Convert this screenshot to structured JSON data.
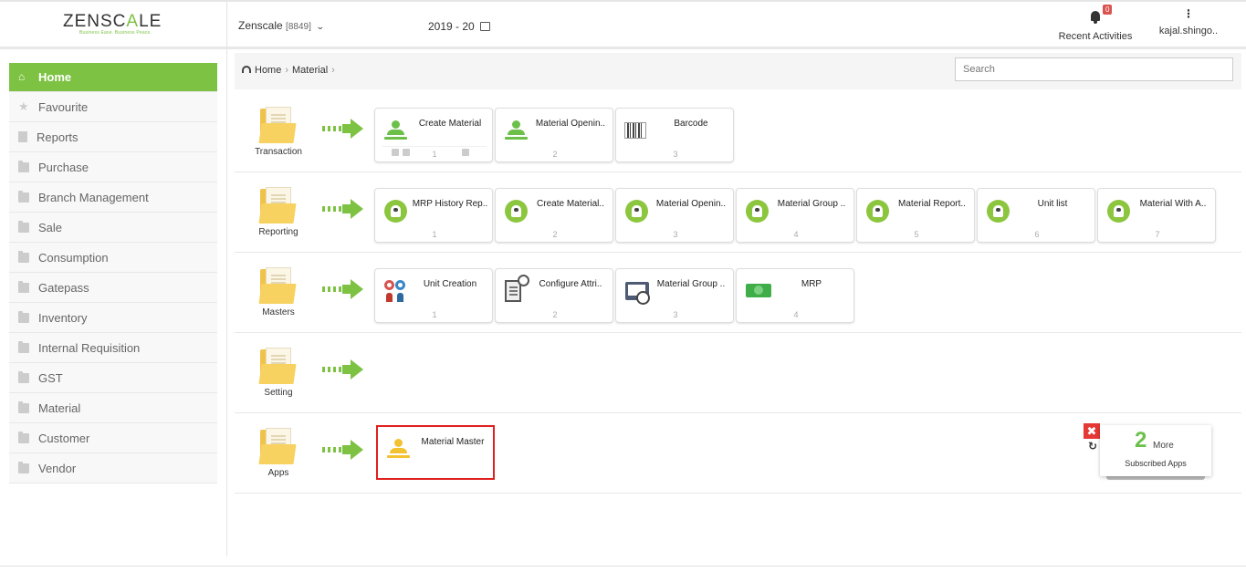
{
  "header": {
    "logo": "ZENSCALE",
    "logo_pre": "ZENSC",
    "logo_accent": "A",
    "logo_post": "LE",
    "tagline": "Business Ease. Business Peace.",
    "company_name": "Zenscale",
    "company_code": "[8849]",
    "fiscal_year": "2019 - 20",
    "activities_label": "Recent Activities",
    "activities_count": "0",
    "user_name": "kajal.shingo.."
  },
  "sidebar": {
    "items": [
      {
        "label": "Home",
        "icon": "home-icon"
      },
      {
        "label": "Favourite",
        "icon": "star-icon"
      },
      {
        "label": "Reports",
        "icon": "file-icon"
      },
      {
        "label": "Purchase",
        "icon": "folder-icon"
      },
      {
        "label": "Branch Management",
        "icon": "folder-icon"
      },
      {
        "label": "Sale",
        "icon": "folder-icon"
      },
      {
        "label": "Consumption",
        "icon": "folder-icon"
      },
      {
        "label": "Gatepass",
        "icon": "folder-icon"
      },
      {
        "label": "Inventory",
        "icon": "folder-icon"
      },
      {
        "label": "Internal Requisition",
        "icon": "folder-icon"
      },
      {
        "label": "GST",
        "icon": "folder-icon"
      },
      {
        "label": "Material",
        "icon": "folder-icon"
      },
      {
        "label": "Customer",
        "icon": "folder-icon"
      },
      {
        "label": "Vendor",
        "icon": "folder-icon"
      }
    ]
  },
  "breadcrumb": {
    "home": "Home",
    "current": "Material"
  },
  "search": {
    "placeholder": "Search"
  },
  "rows": [
    {
      "label": "Transaction",
      "tiles": [
        {
          "title": "Create Material",
          "num": "1",
          "icon": "person-icon"
        },
        {
          "title": "Material Openin..",
          "num": "2",
          "icon": "person-icon"
        },
        {
          "title": "Barcode",
          "num": "3",
          "icon": "barcode-icon"
        }
      ]
    },
    {
      "label": "Reporting",
      "tiles": [
        {
          "title": "MRP History Rep..",
          "num": "1",
          "icon": "report-icon"
        },
        {
          "title": "Create Material..",
          "num": "2",
          "icon": "report-icon"
        },
        {
          "title": "Material Openin..",
          "num": "3",
          "icon": "report-icon"
        },
        {
          "title": "Material Group ..",
          "num": "4",
          "icon": "report-icon"
        },
        {
          "title": "Material Report..",
          "num": "5",
          "icon": "report-icon"
        },
        {
          "title": "Unit list",
          "num": "6",
          "icon": "report-icon"
        },
        {
          "title": "Material With A..",
          "num": "7",
          "icon": "report-icon"
        }
      ]
    },
    {
      "label": "Masters",
      "tiles": [
        {
          "title": "Unit Creation",
          "num": "1",
          "icon": "gears-icon"
        },
        {
          "title": "Configure Attri..",
          "num": "2",
          "icon": "document-settings-icon"
        },
        {
          "title": "Material Group ..",
          "num": "3",
          "icon": "folder-settings-icon"
        },
        {
          "title": "MRP",
          "num": "4",
          "icon": "money-icon"
        }
      ]
    },
    {
      "label": "Setting",
      "tiles": []
    },
    {
      "label": "Apps",
      "tiles": [
        {
          "title": "Material Master",
          "num": "",
          "icon": "person-icon"
        }
      ]
    }
  ],
  "more_apps": {
    "count": "2",
    "word": "More",
    "subtitle": "Subscribed Apps"
  },
  "colors": {
    "accent": "#7dc242",
    "selected_border": "#e02020"
  }
}
